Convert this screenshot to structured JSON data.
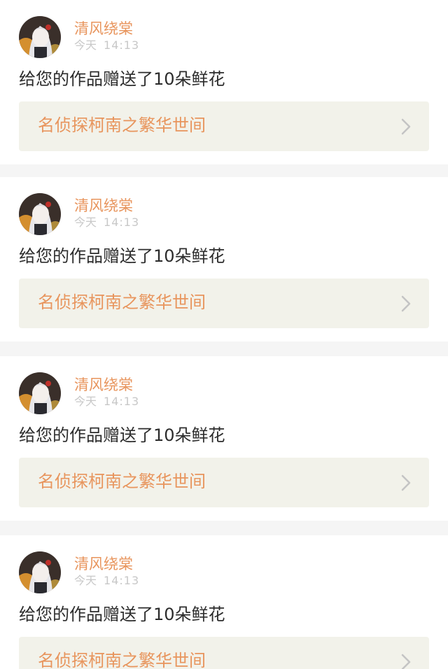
{
  "items": [
    {
      "username": "清风绕棠",
      "date_label": "今天",
      "time": "14:13",
      "message": "给您的作品赠送了10朵鲜花",
      "work_title": "名侦探柯南之繁华世间"
    },
    {
      "username": "清风绕棠",
      "date_label": "今天",
      "time": "14:13",
      "message": "给您的作品赠送了10朵鲜花",
      "work_title": "名侦探柯南之繁华世间"
    },
    {
      "username": "清风绕棠",
      "date_label": "今天",
      "time": "14:13",
      "message": "给您的作品赠送了10朵鲜花",
      "work_title": "名侦探柯南之繁华世间"
    },
    {
      "username": "清风绕棠",
      "date_label": "今天",
      "time": "14:13",
      "message": "给您的作品赠送了10朵鲜花",
      "work_title": "名侦探柯南之繁华世间"
    }
  ],
  "colors": {
    "accent": "#e8955d",
    "link_background": "#f2f2ea",
    "separator": "#f5f5f5"
  },
  "icons": {
    "avatar": "anime-girl-avatar-icon",
    "link_arrow": "chevron-right-icon"
  }
}
